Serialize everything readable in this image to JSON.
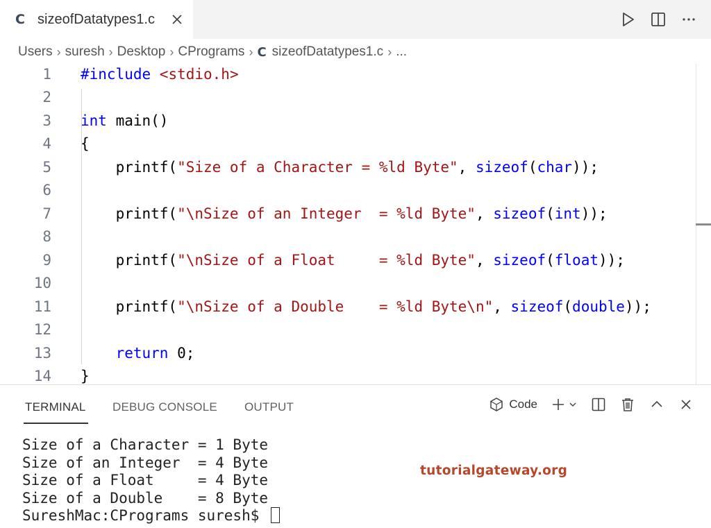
{
  "tab": {
    "icon": "c-language-icon",
    "label": "sizeofDatatypes1.c",
    "close_icon": "close-icon"
  },
  "editor_actions": [
    {
      "icon": "run-icon"
    },
    {
      "icon": "split-editor-icon"
    },
    {
      "icon": "more-actions-icon"
    }
  ],
  "breadcrumb": {
    "items": [
      "Users",
      "suresh",
      "Desktop",
      "CPrograms"
    ],
    "file": "sizeofDatatypes1.c",
    "ellipsis": "..."
  },
  "code_lines": [
    {
      "n": "1",
      "parts": [
        [
          "pp",
          "#include "
        ],
        [
          "hd",
          "<stdio.h>"
        ]
      ]
    },
    {
      "n": "2",
      "parts": []
    },
    {
      "n": "3",
      "parts": [
        [
          "kw",
          "int"
        ],
        [
          "plain",
          " main()"
        ]
      ]
    },
    {
      "n": "4",
      "parts": [
        [
          "plain",
          "{"
        ]
      ]
    },
    {
      "n": "5",
      "parts": [
        [
          "plain",
          "    printf("
        ],
        [
          "str",
          "\"Size of a Character = %ld Byte\""
        ],
        [
          "plain",
          ", "
        ],
        [
          "kw",
          "sizeof"
        ],
        [
          "plain",
          "("
        ],
        [
          "kw",
          "char"
        ],
        [
          "plain",
          "));"
        ]
      ]
    },
    {
      "n": "6",
      "parts": []
    },
    {
      "n": "7",
      "parts": [
        [
          "plain",
          "    printf("
        ],
        [
          "str",
          "\"\\nSize of an Integer  = %ld Byte\""
        ],
        [
          "plain",
          ", "
        ],
        [
          "kw",
          "sizeof"
        ],
        [
          "plain",
          "("
        ],
        [
          "kw",
          "int"
        ],
        [
          "plain",
          "));"
        ]
      ]
    },
    {
      "n": "8",
      "parts": []
    },
    {
      "n": "9",
      "parts": [
        [
          "plain",
          "    printf("
        ],
        [
          "str",
          "\"\\nSize of a Float     = %ld Byte\""
        ],
        [
          "plain",
          ", "
        ],
        [
          "kw",
          "sizeof"
        ],
        [
          "plain",
          "("
        ],
        [
          "kw",
          "float"
        ],
        [
          "plain",
          "));"
        ]
      ]
    },
    {
      "n": "10",
      "parts": []
    },
    {
      "n": "11",
      "parts": [
        [
          "plain",
          "    printf("
        ],
        [
          "str",
          "\"\\nSize of a Double    = %ld Byte\\n\""
        ],
        [
          "plain",
          ", "
        ],
        [
          "kw",
          "sizeof"
        ],
        [
          "plain",
          "("
        ],
        [
          "kw",
          "double"
        ],
        [
          "plain",
          "));"
        ]
      ]
    },
    {
      "n": "12",
      "parts": []
    },
    {
      "n": "13",
      "parts": [
        [
          "plain",
          "    "
        ],
        [
          "kw",
          "return"
        ],
        [
          "plain",
          " 0;"
        ]
      ]
    },
    {
      "n": "14",
      "parts": [
        [
          "plain",
          "}"
        ]
      ]
    }
  ],
  "panel": {
    "tabs": [
      "TERMINAL",
      "DEBUG CONSOLE",
      "OUTPUT"
    ],
    "active_tab": "TERMINAL",
    "shell_label": "Code",
    "actions": [
      "terminal-shell-icon",
      "add-terminal-icon",
      "chevron-down-icon",
      "split-terminal-icon",
      "trash-icon",
      "maximize-panel-icon",
      "close-panel-icon"
    ]
  },
  "terminal": {
    "lines": [
      "Size of a Character = 1 Byte",
      "Size of an Integer  = 4 Byte",
      "Size of a Float     = 4 Byte",
      "Size of a Double    = 8 Byte"
    ],
    "prompt": "SureshMac:CPrograms suresh$ "
  },
  "watermark": "tutorialgateway.org",
  "colors": {
    "keyword": "#0000ff",
    "string": "#a31515",
    "line_number": "#6e7681",
    "watermark": "#b5482b"
  }
}
